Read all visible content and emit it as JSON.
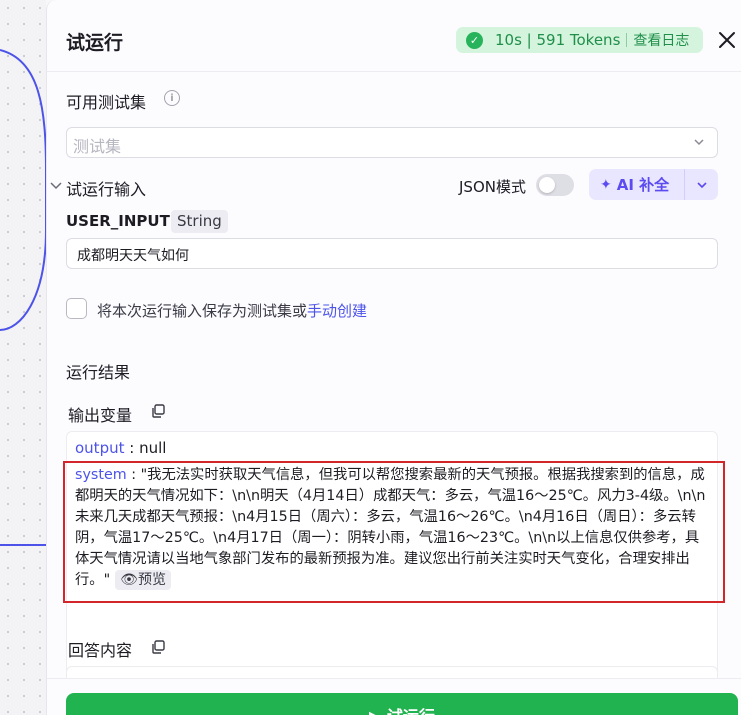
{
  "header": {
    "title": "试运行",
    "status_text": "10s | 591 Tokens",
    "log_label": "查看日志"
  },
  "test_set": {
    "label": "可用测试集",
    "placeholder": "测试集"
  },
  "run_input": {
    "label": "试运行输入",
    "json_mode_label": "JSON模式",
    "json_mode_on": false,
    "ai_button_label": "AI 补全",
    "var_name": "USER_INPUT",
    "var_type": "String",
    "value": "成都明天天气如何"
  },
  "save_option": {
    "text": "将本次运行输入保存为测试集或",
    "link": "手动创建",
    "checked": false
  },
  "result": {
    "section_label": "运行结果",
    "output_label": "输出变量",
    "output_key": "output",
    "output_sep": " : ",
    "output_value": "null",
    "system_key": "system",
    "system_sep": " : ",
    "system_value": "\"我无法实时获取天气信息，但我可以帮您搜索最新的天气预报。根据我搜索到的信息，成都明天的天气情况如下：\\n\\n明天（4月14日）成都天气：多云，气温16～25℃。风力3-4级。\\n\\n未来几天成都天气预报：\\n4月15日（周六）：多云，气温16～26℃。\\n4月16日（周日）：多云转阴，气温17～25℃。\\n4月17日（周一）：阴转小雨，气温16～23℃。\\n\\n以上信息仅供参考，具体天气情况请以当地气象部门发布的最新预报为准。建议您出行前关注实时天气变化，合理安排出行。\"",
    "preview_label": "预览",
    "answer_label": "回答内容"
  },
  "footer": {
    "run_button_label": "▶ 试运行"
  },
  "colors": {
    "accent": "#4d53e8",
    "success_bg": "#d4f4dd",
    "success_text": "#1f8f4a",
    "run_button": "#21b34f",
    "highlight_border": "#d3262b"
  }
}
